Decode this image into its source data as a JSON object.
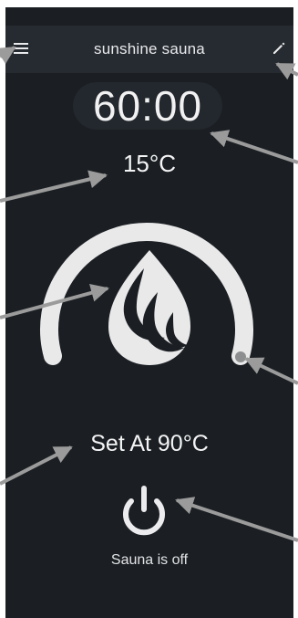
{
  "header": {
    "title": "sunshine sauna",
    "menu_icon": "menu-icon",
    "edit_icon": "pencil-icon"
  },
  "timer": {
    "value": "60:00"
  },
  "current_temperature": "15°C",
  "thermostat": {
    "center_icon": "flame-icon",
    "level_fraction": 0.0
  },
  "setpoint": "Set At 90°C",
  "power": {
    "icon": "power-icon",
    "status": "Sauna is off"
  },
  "colors": {
    "background": "#1b1f23",
    "header": "#262b31",
    "arc": "#e9e9ea",
    "text": "#f4f4f5",
    "annotation_arrow": "#9b9b9b"
  }
}
